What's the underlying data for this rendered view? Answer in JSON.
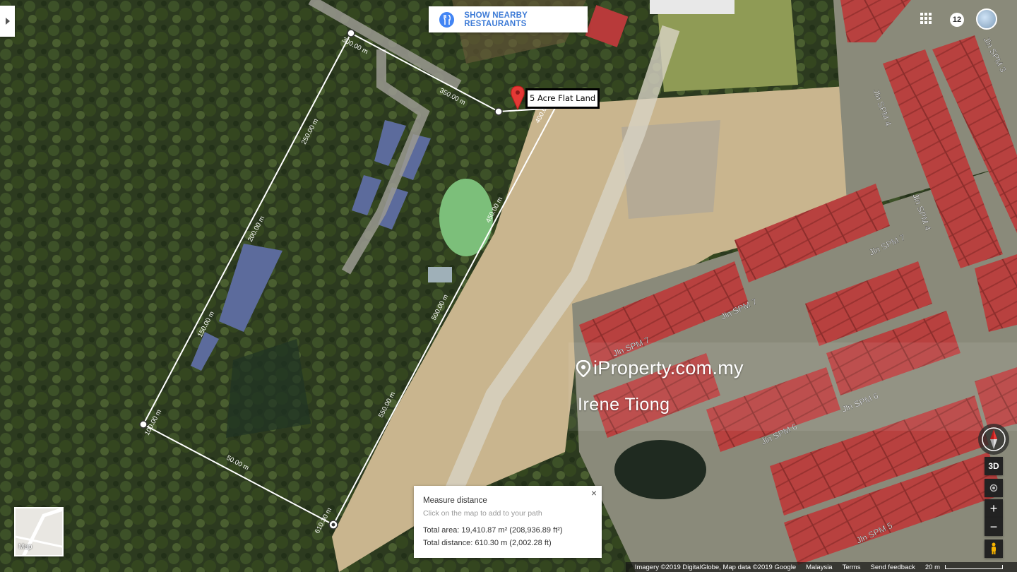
{
  "map": {
    "style": "satellite",
    "measurement_labels": [
      {
        "text": "300.00 m"
      },
      {
        "text": "350.00 m"
      },
      {
        "text": "400.00 m"
      },
      {
        "text": "450.00 m"
      },
      {
        "text": "500.00 m"
      },
      {
        "text": "550.00 m"
      },
      {
        "text": "610.30 m"
      },
      {
        "text": "50.00 m"
      },
      {
        "text": "100.00 m"
      },
      {
        "text": "150.00 m"
      },
      {
        "text": "200.00 m"
      },
      {
        "text": "250.00 m"
      }
    ],
    "street_labels": [
      "Jln SPM 3",
      "Jln SPM 4",
      "Jln SPM 4",
      "Jln SPM 7",
      "Jln SPM 7",
      "Jln SPM 7",
      "Jln SPM 6",
      "Jln SPM 6",
      "Jln SPM 5"
    ],
    "pin_label": "5 Acre Flat Land",
    "colors": {
      "measure_line": "#ffffff",
      "pin": "#e53935",
      "roof": "#b83a3a",
      "soil": "#c9b58e"
    }
  },
  "restaurants_button": {
    "label": "SHOW NEARBY RESTAURANTS",
    "icon": "fork-knife-icon"
  },
  "header": {
    "notifications": "12"
  },
  "watermark": {
    "brand": "iProperty.com.my",
    "agent": "Irene Tiong"
  },
  "measure": {
    "title": "Measure distance",
    "hint": "Click on the map to add to your path",
    "area": "Total area: 19,410.87 m² (208,936.89 ft²)",
    "distance": "Total distance: 610.30 m (2,002.28 ft)"
  },
  "controls": {
    "btn_3d": "3D",
    "zoom_in": "+",
    "zoom_out": "−",
    "map_type_label": "Map"
  },
  "attribution": {
    "imagery": "Imagery ©2019 DigitalGlobe, Map data ©2019 Google",
    "country": "Malaysia",
    "terms": "Terms",
    "feedback": "Send feedback",
    "scale": "20 m"
  }
}
